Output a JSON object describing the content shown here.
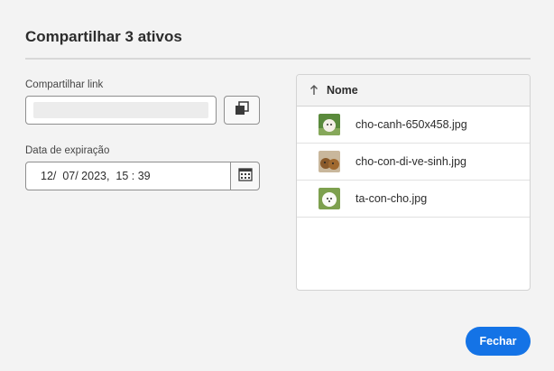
{
  "dialog": {
    "title": "Compartilhar 3 ativos"
  },
  "share_link": {
    "label": "Compartilhar link",
    "value": "",
    "copy_icon": "copy-icon"
  },
  "expiration": {
    "label": "Data de expiração",
    "value": "12/  07/ 2023,  15 : 39",
    "calendar_icon": "calendar-icon"
  },
  "files_table": {
    "column_header": "Nome",
    "sort_icon": "arrow-up-icon",
    "rows": [
      {
        "name": "cho-canh-650x458.jpg"
      },
      {
        "name": "cho-con-di-ve-sinh.jpg"
      },
      {
        "name": "ta-con-cho.jpg"
      }
    ]
  },
  "footer": {
    "close_label": "Fechar"
  },
  "colors": {
    "accent": "#1473e6",
    "background": "#f3f3f3"
  }
}
